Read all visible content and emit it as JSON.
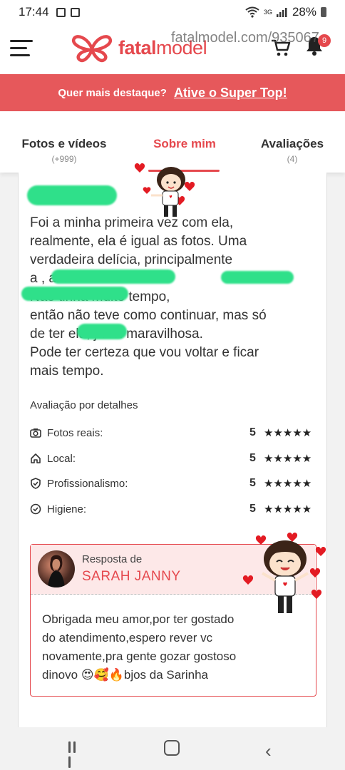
{
  "status_bar": {
    "time": "17:44",
    "network": "3G",
    "battery": "28%"
  },
  "header": {
    "logo_text_bold": "fatal",
    "logo_text_normal": "model",
    "notification_count": "9"
  },
  "watermark": "fatalmodel.com/935067",
  "promo": {
    "question": "Quer mais destaque?",
    "cta": "Ative o Super Top!"
  },
  "tabs": [
    {
      "label": "Fotos e vídeos",
      "count": "(+999)"
    },
    {
      "label": "Sobre mim",
      "count": ""
    },
    {
      "label": "Avaliações",
      "count": "(4)"
    }
  ],
  "review": {
    "text": "Foi a minha primeira vez com ela,\nrealmente, ela é igual as fotos. Uma\nverdadeira delícia, principalmente\na           , ainda\n           Não tinha muito tempo,\nentão não teve como continuar, mas só\nde ter           ela, já foi maravilhosa.\nPode ter certeza que vou voltar e ficar\nmais tempo."
  },
  "details": {
    "title": "Avaliação por detalhes",
    "items": [
      {
        "label": "Fotos reais:",
        "score": "5",
        "stars": "★★★★★",
        "icon": "camera-icon"
      },
      {
        "label": "Local:",
        "score": "5",
        "stars": "★★★★★",
        "icon": "home-icon"
      },
      {
        "label": "Profissionalismo:",
        "score": "5",
        "stars": "★★★★★",
        "icon": "shield-check-icon"
      },
      {
        "label": "Higiene:",
        "score": "5",
        "stars": "★★★★★",
        "icon": "check-circle-icon"
      }
    ]
  },
  "response": {
    "label": "Resposta de",
    "name": "SARAH JANNY",
    "text": "Obrigada meu amor,por ter gostado\ndo atendimento,espero rever vc\nnovamente,pra gente gozar gostoso\ndinovo 😍🥰🔥bjos da Sarinha"
  },
  "colors": {
    "brand": "#e5484d",
    "promo_bg": "#e6585b",
    "response_bg": "#fde8e8",
    "censor": "#2fe08a"
  }
}
